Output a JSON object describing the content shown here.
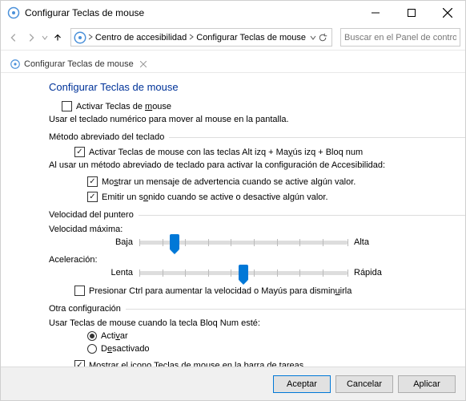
{
  "window": {
    "title": "Configurar Teclas de mouse"
  },
  "breadcrumb": {
    "part1": "Centro de accesibilidad",
    "part2": "Configurar Teclas de mouse"
  },
  "search": {
    "placeholder": "Buscar en el Panel de control"
  },
  "tab": {
    "label": "Configurar Teclas de mouse"
  },
  "page": {
    "heading": "Configurar Teclas de mouse",
    "activateCheckbox_pre": "Activar Teclas de ",
    "activateCheckbox_u": "m",
    "activateCheckbox_post": "ouse",
    "activateDesc": "Usar el teclado numérico para mover al mouse en la pantalla.",
    "groupShortcut_label": "Método abreviado del teclado",
    "shortcutCheckLabel_pre": "Activar Teclas de mouse con las teclas Alt izq + Ma",
    "shortcutCheckLabel_u": "y",
    "shortcutCheckLabel_post": "ús izq + Bloq num",
    "shortcutDesc": "Al usar un método abreviado de teclado para activar la configuración de Accesibilidad:",
    "warnCheck_pre": "Mo",
    "warnCheck_u": "s",
    "warnCheck_post": "trar un mensaje de advertencia cuando se active algún valor.",
    "soundCheck_pre": "Emitir un s",
    "soundCheck_u": "o",
    "soundCheck_post": "nido cuando se active o desactive algún valor.",
    "groupSpeed_label": "Velocidad del puntero",
    "maxSpeedLabel": "Velocidad máxima:",
    "lowLabel": "Baja",
    "highLabel": "Alta",
    "accelLabel": "Aceleración:",
    "slowLabel": "Lenta",
    "fastLabel": "Rápida",
    "ctrlCheck_pre": "Presionar Ctrl para aumentar la velocidad o Mayús para dismin",
    "ctrlCheck_u": "u",
    "ctrlCheck_post": "irla",
    "groupOther_label": "Otra configuración",
    "numLockLabel": "Usar Teclas de mouse cuando la tecla Bloq Num esté:",
    "radioOn_pre": "Acti",
    "radioOn_u": "v",
    "radioOn_post": "ar",
    "radioOff_pre": "D",
    "radioOff_u": "e",
    "radioOff_post": "sactivado",
    "taskbarCheck_pre": "Mostrar el ",
    "taskbarCheck_u": "i",
    "taskbarCheck_post": "cono Teclas de mouse en la barra de tareas"
  },
  "buttons": {
    "ok": "Aceptar",
    "cancel": "Cancelar",
    "apply": "Aplicar"
  },
  "sliders": {
    "maxSpeed": 17,
    "accel": 50
  }
}
